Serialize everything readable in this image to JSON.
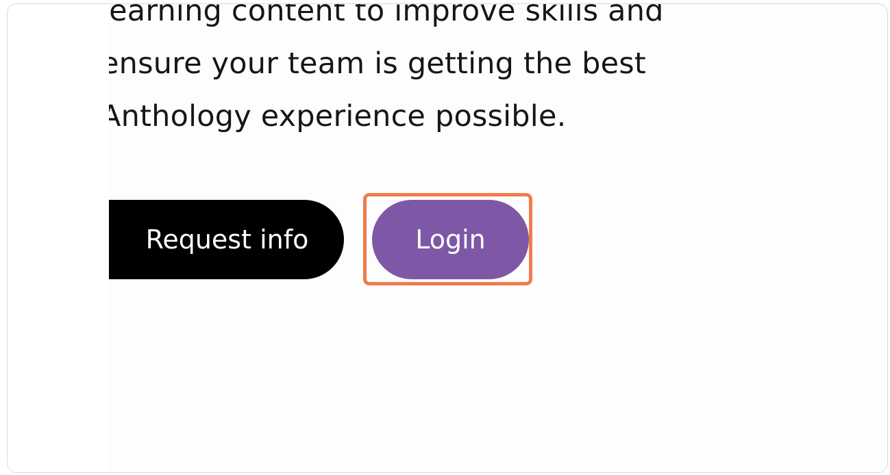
{
  "content": {
    "paragraph_lines": [
      "learning content to improve skills and",
      "ensure your team is getting the best",
      "Anthology experience possible."
    ]
  },
  "actions": {
    "request_info_label": "Request info",
    "login_label": "Login"
  },
  "colors": {
    "request_button_bg": "#000000",
    "login_button_bg": "#7e58a6",
    "highlight_border": "#f27b4c",
    "text": "#161616"
  }
}
